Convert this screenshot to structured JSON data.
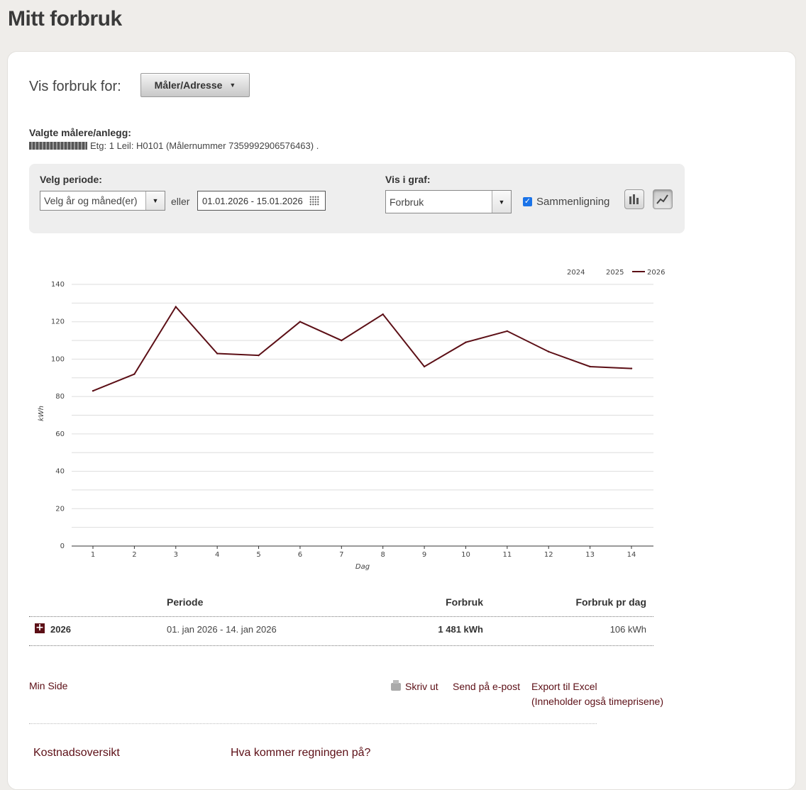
{
  "page": {
    "title": "Mitt forbruk"
  },
  "selector": {
    "label": "Vis forbruk for:",
    "dropdown_value": "Måler/Adresse"
  },
  "selected": {
    "title": "Valgte målere/anlegg:",
    "meter_text": "Etg: 1 Leil: H0101 (Målernummer 7359992906576463) ."
  },
  "filters": {
    "period_label": "Velg periode:",
    "period_select": "Velg år og måned(er)",
    "or_label": "eller",
    "date_range": "01.01.2026 - 15.01.2026",
    "graph_label": "Vis i graf:",
    "graph_select": "Forbruk",
    "comparison_label": "Sammenligning",
    "comparison_checked": true,
    "bar_icon": "bar-chart-icon",
    "line_icon": "line-chart-icon"
  },
  "chart_data": {
    "type": "line",
    "x": [
      1,
      2,
      3,
      4,
      5,
      6,
      7,
      8,
      9,
      10,
      11,
      12,
      13,
      14
    ],
    "series": [
      {
        "name": "2024",
        "values": []
      },
      {
        "name": "2025",
        "values": []
      },
      {
        "name": "2026",
        "values": [
          83,
          92,
          128,
          103,
          102,
          120,
          110,
          124,
          96,
          109,
          115,
          104,
          96,
          95
        ],
        "color": "#5c0f16"
      }
    ],
    "xlabel": "Dag",
    "ylabel": "kWh",
    "ylim": [
      0,
      140
    ],
    "yticks": [
      0,
      20,
      40,
      60,
      80,
      100,
      120,
      140
    ],
    "grid": true,
    "legend": "top-right"
  },
  "table": {
    "headers": {
      "period": "Periode",
      "usage": "Forbruk",
      "per_day": "Forbruk pr dag"
    },
    "rows": [
      {
        "year": "2026",
        "period": "01. jan 2026 - 14. jan 2026",
        "usage": "1 481 kWh",
        "per_day": "106 kWh"
      }
    ]
  },
  "links": {
    "min_side": "Min Side",
    "print": "Skriv ut",
    "email": "Send på e-post",
    "excel": "Export til Excel",
    "excel_note": "(Inneholder også timeprisene)"
  },
  "bottom": {
    "cost_overview": "Kostnadsoversikt",
    "bill_info": "Hva kommer regningen på?"
  },
  "colors": {
    "accent": "#5c0f16",
    "background": "#efedea"
  }
}
